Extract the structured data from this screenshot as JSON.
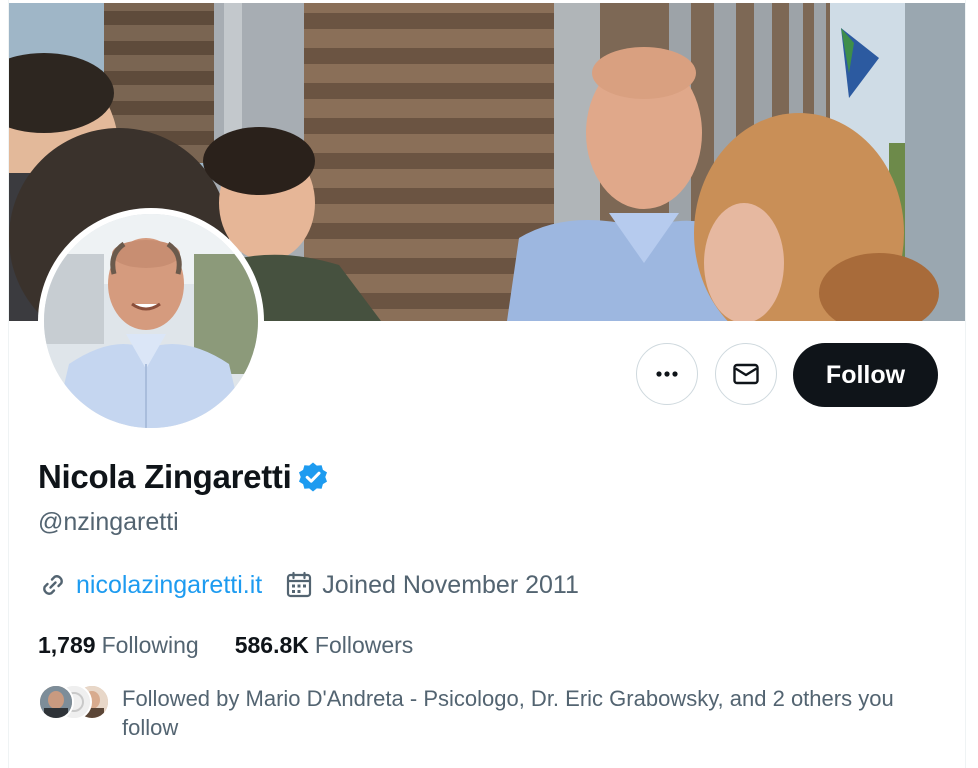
{
  "profile": {
    "name": "Nicola Zingaretti",
    "handle": "@nzingaretti",
    "website": "nicolazingaretti.it",
    "joined": "Joined November 2011",
    "following_count": "1,789",
    "following_label": "Following",
    "followers_count": "586.8K",
    "followers_label": "Followers",
    "followed_by": "Followed by Mario D'Andreta - Psicologo, Dr. Eric Grabowsky, and 2 others you follow"
  },
  "actions": {
    "follow_label": "Follow"
  },
  "icons": {
    "more": "more-icon",
    "message": "mail-icon",
    "verified": "verified-badge-icon",
    "link": "link-icon",
    "calendar": "calendar-icon"
  },
  "colors": {
    "accent": "#1d9bf0",
    "follow_bg": "#0f1419",
    "secondary_text": "#536471"
  }
}
